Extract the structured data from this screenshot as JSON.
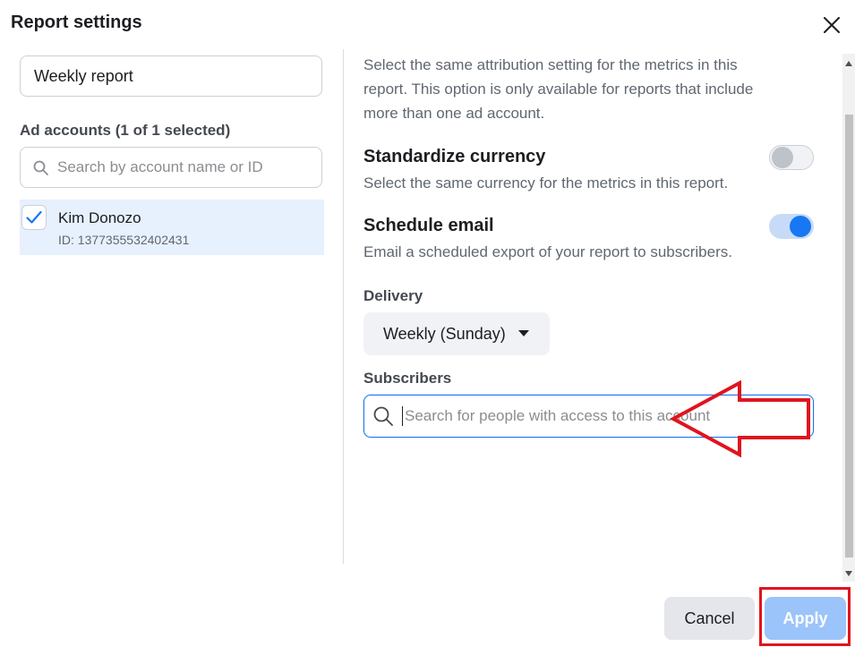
{
  "dialog": {
    "title": "Report settings"
  },
  "left": {
    "report_name_value": "Weekly report",
    "ad_accounts_label": "Ad accounts (1 of 1 selected)",
    "search_placeholder": "Search by account name or ID",
    "accounts": [
      {
        "name": "Kim Donozo",
        "id": "ID: 1377355532402431",
        "checked": true
      }
    ]
  },
  "right": {
    "attribution_text_lines": [
      "Select the same attribution setting for the metrics in this",
      "report. This option is only available for reports that include",
      "more than one ad account."
    ],
    "standardize_currency": {
      "heading": "Standardize currency",
      "description": "Select the same currency for the metrics in this report.",
      "enabled": false
    },
    "schedule_email": {
      "heading": "Schedule email",
      "description": "Email a scheduled export of your report to subscribers.",
      "enabled": true
    },
    "delivery": {
      "label": "Delivery",
      "selected": "Weekly (Sunday)"
    },
    "subscribers": {
      "label": "Subscribers",
      "placeholder": "Search for people with access to this account"
    }
  },
  "footer": {
    "cancel_label": "Cancel",
    "apply_label": "Apply"
  },
  "colors": {
    "accent": "#1877f2",
    "apply_disabled": "#9bc4fa",
    "annotation_red": "#e0141e",
    "selected_row": "#e7f0fd"
  },
  "icons": [
    "close-icon",
    "search-icon",
    "check-icon",
    "caret-down-icon",
    "red-arrow-annotation",
    "red-box-annotation"
  ]
}
